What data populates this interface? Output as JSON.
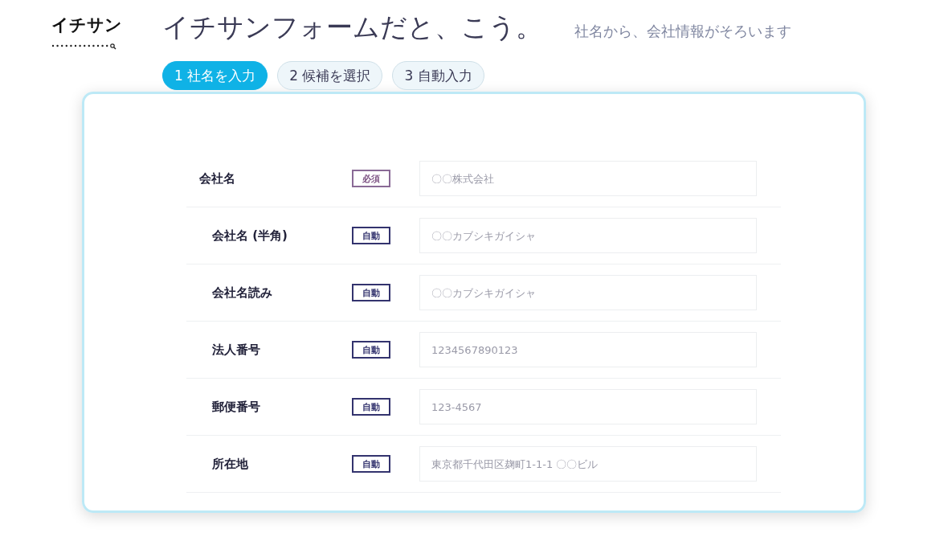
{
  "logo": {
    "text": "イチサン"
  },
  "title": "イチサンフォームだと、こう。",
  "subtitle": "社名から、会社情報がそろいます",
  "steps": [
    {
      "label": "1  社名を入力",
      "selected": true
    },
    {
      "label": "2  候補を選択",
      "selected": false
    },
    {
      "label": "3  自動入力",
      "selected": false
    }
  ],
  "form_rows": [
    {
      "label": "会社名",
      "kind": "main",
      "badge": {
        "text": "必須",
        "kind": "required"
      },
      "placeholder": "〇〇株式会社"
    },
    {
      "label": "会社名 (半角)",
      "kind": "sub",
      "badge": {
        "text": "自動",
        "kind": "auto"
      },
      "placeholder": "〇〇カブシキガイシャ"
    },
    {
      "label": "会社名読み",
      "kind": "sub",
      "badge": {
        "text": "自動",
        "kind": "auto"
      },
      "placeholder": "〇〇カブシキガイシャ"
    },
    {
      "label": "法人番号",
      "kind": "sub",
      "badge": {
        "text": "自動",
        "kind": "auto"
      },
      "placeholder": "1234567890123"
    },
    {
      "label": "郵便番号",
      "kind": "sub",
      "badge": {
        "text": "自動",
        "kind": "auto"
      },
      "placeholder": "123-4567"
    },
    {
      "label": "所在地",
      "kind": "sub",
      "badge": {
        "text": "自動",
        "kind": "auto"
      },
      "placeholder": "東京都千代田区麹町1-1-1 〇〇ビル"
    }
  ]
}
